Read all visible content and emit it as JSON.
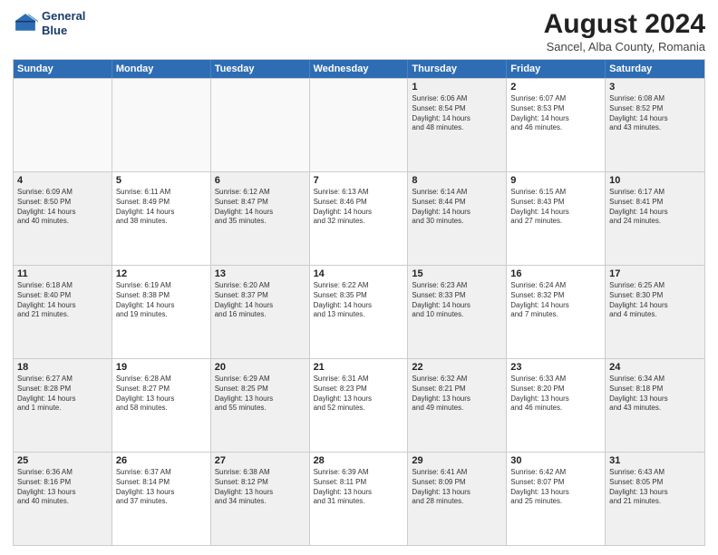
{
  "header": {
    "logo_line1": "General",
    "logo_line2": "Blue",
    "title": "August 2024",
    "subtitle": "Sancel, Alba County, Romania"
  },
  "days_of_week": [
    "Sunday",
    "Monday",
    "Tuesday",
    "Wednesday",
    "Thursday",
    "Friday",
    "Saturday"
  ],
  "weeks": [
    [
      {
        "day": "",
        "empty": true
      },
      {
        "day": "",
        "empty": true
      },
      {
        "day": "",
        "empty": true
      },
      {
        "day": "",
        "empty": true
      },
      {
        "day": "1",
        "shaded": true,
        "lines": [
          "Sunrise: 6:06 AM",
          "Sunset: 8:54 PM",
          "Daylight: 14 hours",
          "and 48 minutes."
        ]
      },
      {
        "day": "2",
        "shaded": false,
        "lines": [
          "Sunrise: 6:07 AM",
          "Sunset: 8:53 PM",
          "Daylight: 14 hours",
          "and 46 minutes."
        ]
      },
      {
        "day": "3",
        "shaded": true,
        "lines": [
          "Sunrise: 6:08 AM",
          "Sunset: 8:52 PM",
          "Daylight: 14 hours",
          "and 43 minutes."
        ]
      }
    ],
    [
      {
        "day": "4",
        "shaded": true,
        "lines": [
          "Sunrise: 6:09 AM",
          "Sunset: 8:50 PM",
          "Daylight: 14 hours",
          "and 40 minutes."
        ]
      },
      {
        "day": "5",
        "shaded": false,
        "lines": [
          "Sunrise: 6:11 AM",
          "Sunset: 8:49 PM",
          "Daylight: 14 hours",
          "and 38 minutes."
        ]
      },
      {
        "day": "6",
        "shaded": true,
        "lines": [
          "Sunrise: 6:12 AM",
          "Sunset: 8:47 PM",
          "Daylight: 14 hours",
          "and 35 minutes."
        ]
      },
      {
        "day": "7",
        "shaded": false,
        "lines": [
          "Sunrise: 6:13 AM",
          "Sunset: 8:46 PM",
          "Daylight: 14 hours",
          "and 32 minutes."
        ]
      },
      {
        "day": "8",
        "shaded": true,
        "lines": [
          "Sunrise: 6:14 AM",
          "Sunset: 8:44 PM",
          "Daylight: 14 hours",
          "and 30 minutes."
        ]
      },
      {
        "day": "9",
        "shaded": false,
        "lines": [
          "Sunrise: 6:15 AM",
          "Sunset: 8:43 PM",
          "Daylight: 14 hours",
          "and 27 minutes."
        ]
      },
      {
        "day": "10",
        "shaded": true,
        "lines": [
          "Sunrise: 6:17 AM",
          "Sunset: 8:41 PM",
          "Daylight: 14 hours",
          "and 24 minutes."
        ]
      }
    ],
    [
      {
        "day": "11",
        "shaded": true,
        "lines": [
          "Sunrise: 6:18 AM",
          "Sunset: 8:40 PM",
          "Daylight: 14 hours",
          "and 21 minutes."
        ]
      },
      {
        "day": "12",
        "shaded": false,
        "lines": [
          "Sunrise: 6:19 AM",
          "Sunset: 8:38 PM",
          "Daylight: 14 hours",
          "and 19 minutes."
        ]
      },
      {
        "day": "13",
        "shaded": true,
        "lines": [
          "Sunrise: 6:20 AM",
          "Sunset: 8:37 PM",
          "Daylight: 14 hours",
          "and 16 minutes."
        ]
      },
      {
        "day": "14",
        "shaded": false,
        "lines": [
          "Sunrise: 6:22 AM",
          "Sunset: 8:35 PM",
          "Daylight: 14 hours",
          "and 13 minutes."
        ]
      },
      {
        "day": "15",
        "shaded": true,
        "lines": [
          "Sunrise: 6:23 AM",
          "Sunset: 8:33 PM",
          "Daylight: 14 hours",
          "and 10 minutes."
        ]
      },
      {
        "day": "16",
        "shaded": false,
        "lines": [
          "Sunrise: 6:24 AM",
          "Sunset: 8:32 PM",
          "Daylight: 14 hours",
          "and 7 minutes."
        ]
      },
      {
        "day": "17",
        "shaded": true,
        "lines": [
          "Sunrise: 6:25 AM",
          "Sunset: 8:30 PM",
          "Daylight: 14 hours",
          "and 4 minutes."
        ]
      }
    ],
    [
      {
        "day": "18",
        "shaded": true,
        "lines": [
          "Sunrise: 6:27 AM",
          "Sunset: 8:28 PM",
          "Daylight: 14 hours",
          "and 1 minute."
        ]
      },
      {
        "day": "19",
        "shaded": false,
        "lines": [
          "Sunrise: 6:28 AM",
          "Sunset: 8:27 PM",
          "Daylight: 13 hours",
          "and 58 minutes."
        ]
      },
      {
        "day": "20",
        "shaded": true,
        "lines": [
          "Sunrise: 6:29 AM",
          "Sunset: 8:25 PM",
          "Daylight: 13 hours",
          "and 55 minutes."
        ]
      },
      {
        "day": "21",
        "shaded": false,
        "lines": [
          "Sunrise: 6:31 AM",
          "Sunset: 8:23 PM",
          "Daylight: 13 hours",
          "and 52 minutes."
        ]
      },
      {
        "day": "22",
        "shaded": true,
        "lines": [
          "Sunrise: 6:32 AM",
          "Sunset: 8:21 PM",
          "Daylight: 13 hours",
          "and 49 minutes."
        ]
      },
      {
        "day": "23",
        "shaded": false,
        "lines": [
          "Sunrise: 6:33 AM",
          "Sunset: 8:20 PM",
          "Daylight: 13 hours",
          "and 46 minutes."
        ]
      },
      {
        "day": "24",
        "shaded": true,
        "lines": [
          "Sunrise: 6:34 AM",
          "Sunset: 8:18 PM",
          "Daylight: 13 hours",
          "and 43 minutes."
        ]
      }
    ],
    [
      {
        "day": "25",
        "shaded": true,
        "lines": [
          "Sunrise: 6:36 AM",
          "Sunset: 8:16 PM",
          "Daylight: 13 hours",
          "and 40 minutes."
        ]
      },
      {
        "day": "26",
        "shaded": false,
        "lines": [
          "Sunrise: 6:37 AM",
          "Sunset: 8:14 PM",
          "Daylight: 13 hours",
          "and 37 minutes."
        ]
      },
      {
        "day": "27",
        "shaded": true,
        "lines": [
          "Sunrise: 6:38 AM",
          "Sunset: 8:12 PM",
          "Daylight: 13 hours",
          "and 34 minutes."
        ]
      },
      {
        "day": "28",
        "shaded": false,
        "lines": [
          "Sunrise: 6:39 AM",
          "Sunset: 8:11 PM",
          "Daylight: 13 hours",
          "and 31 minutes."
        ]
      },
      {
        "day": "29",
        "shaded": true,
        "lines": [
          "Sunrise: 6:41 AM",
          "Sunset: 8:09 PM",
          "Daylight: 13 hours",
          "and 28 minutes."
        ]
      },
      {
        "day": "30",
        "shaded": false,
        "lines": [
          "Sunrise: 6:42 AM",
          "Sunset: 8:07 PM",
          "Daylight: 13 hours",
          "and 25 minutes."
        ]
      },
      {
        "day": "31",
        "shaded": true,
        "lines": [
          "Sunrise: 6:43 AM",
          "Sunset: 8:05 PM",
          "Daylight: 13 hours",
          "and 21 minutes."
        ]
      }
    ]
  ]
}
